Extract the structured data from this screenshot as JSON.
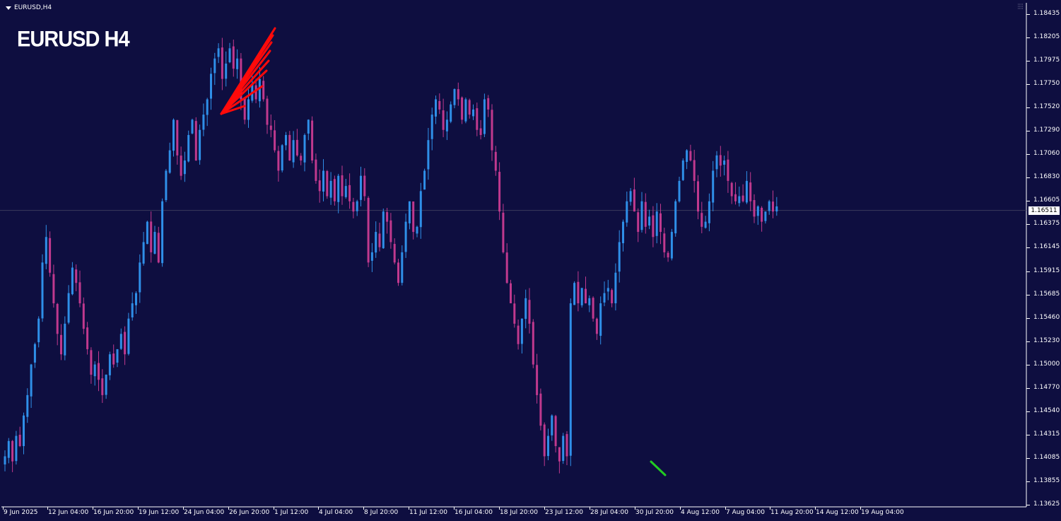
{
  "window": {
    "title": "EURUSD,H4",
    "chart_label": "EURUSD H4",
    "icons": [
      "dropdown-triangle-icon",
      "chart-corner-mark-icon"
    ]
  },
  "colors": {
    "background": "#0e0e40",
    "bull_candle": "#2f8fe8",
    "bear_candle": "#c0398e",
    "arrow_red": "#ff0a0a",
    "arrow_green": "#22cc22",
    "axis_text": "#ffffff",
    "bid_line": "#3a3a5c"
  },
  "current_price": "1.16511",
  "chart_data": {
    "type": "line",
    "symbol": "EURUSD",
    "timeframe": "H4",
    "y_tick_labels": [
      "1.18435",
      "1.18205",
      "1.17975",
      "1.17750",
      "1.17520",
      "1.17290",
      "1.17060",
      "1.16830",
      "1.16605",
      "1.16375",
      "1.16145",
      "1.15915",
      "1.15685",
      "1.15460",
      "1.15230",
      "1.15000",
      "1.14770",
      "1.14540",
      "1.14315",
      "1.14085",
      "1.13855",
      "1.13625"
    ],
    "x_tick_labels": [
      "9 Jun 2025",
      "12 Jun 04:00",
      "16 Jun 20:00",
      "19 Jun 12:00",
      "24 Jun 04:00",
      "26 Jun 20:00",
      "1 Jul 12:00",
      "4 Jul 04:00",
      "8 Jul 20:00",
      "11 Jul 12:00",
      "16 Jul 04:00",
      "18 Jul 20:00",
      "23 Jul 12:00",
      "28 Jul 04:00",
      "30 Jul 20:00",
      "4 Aug 12:00",
      "7 Aug 04:00",
      "11 Aug 20:00",
      "14 Aug 12:00",
      "19 Aug 04:00"
    ],
    "ylim": [
      1.13625,
      1.18435
    ],
    "grid": false,
    "series": [
      {
        "values": [
          1.141,
          1.1425,
          1.1405,
          1.143,
          1.142,
          1.145,
          1.147,
          1.15,
          1.152,
          1.1545,
          1.16,
          1.1625,
          1.159,
          1.156,
          1.153,
          1.151,
          1.154,
          1.157,
          1.1595,
          1.158,
          1.156,
          1.1535,
          1.1515,
          1.149,
          1.15,
          1.1485,
          1.147,
          1.149,
          1.151,
          1.15,
          1.1515,
          1.153,
          1.151,
          1.1545,
          1.156,
          1.157,
          1.16,
          1.162,
          1.164,
          1.161,
          1.163,
          1.16,
          1.166,
          1.169,
          1.171,
          1.174,
          1.1705,
          1.1685,
          1.17,
          1.1725,
          1.174,
          1.17,
          1.173,
          1.1745,
          1.176,
          1.1785,
          1.18,
          1.181,
          1.178,
          1.1795,
          1.181,
          1.179,
          1.18,
          1.176,
          1.174,
          1.176,
          1.1775,
          1.176,
          1.178,
          1.176,
          1.1735,
          1.173,
          1.171,
          1.169,
          1.1715,
          1.1725,
          1.17,
          1.172,
          1.1705,
          1.17,
          1.1725,
          1.174,
          1.17,
          1.168,
          1.167,
          1.169,
          1.1665,
          1.168,
          1.166,
          1.1685,
          1.1665,
          1.1675,
          1.166,
          1.165,
          1.166,
          1.1685,
          1.1665,
          1.16,
          1.161,
          1.163,
          1.1615,
          1.165,
          1.164,
          1.162,
          1.16,
          1.158,
          1.161,
          1.164,
          1.166,
          1.163,
          1.1635,
          1.167,
          1.169,
          1.172,
          1.1745,
          1.176,
          1.175,
          1.173,
          1.174,
          1.1755,
          1.177,
          1.176,
          1.174,
          1.176,
          1.1745,
          1.175,
          1.173,
          1.1725,
          1.176,
          1.175,
          1.171,
          1.169,
          1.165,
          1.161,
          1.158,
          1.156,
          1.154,
          1.152,
          1.1545,
          1.1565,
          1.154,
          1.15,
          1.147,
          1.144,
          1.141,
          1.143,
          1.145,
          1.142,
          1.1405,
          1.143,
          1.141,
          1.156,
          1.158,
          1.156,
          1.1575,
          1.156,
          1.1565,
          1.1545,
          1.153,
          1.156,
          1.157,
          1.1575,
          1.156,
          1.159,
          1.162,
          1.164,
          1.166,
          1.167,
          1.165,
          1.163,
          1.166,
          1.1635,
          1.1645,
          1.1625,
          1.165,
          1.163,
          1.161,
          1.1605,
          1.163,
          1.166,
          1.168,
          1.17,
          1.171,
          1.17,
          1.168,
          1.165,
          1.1635,
          1.164,
          1.166,
          1.169,
          1.1705,
          1.1695,
          1.17,
          1.168,
          1.1665,
          1.166,
          1.1665,
          1.166,
          1.168,
          1.166,
          1.1645,
          1.1655,
          1.164,
          1.165,
          1.166,
          1.165,
          1.1655
        ]
      }
    ],
    "annotations": [
      "red-arrow-fan",
      "green-arrow"
    ]
  }
}
